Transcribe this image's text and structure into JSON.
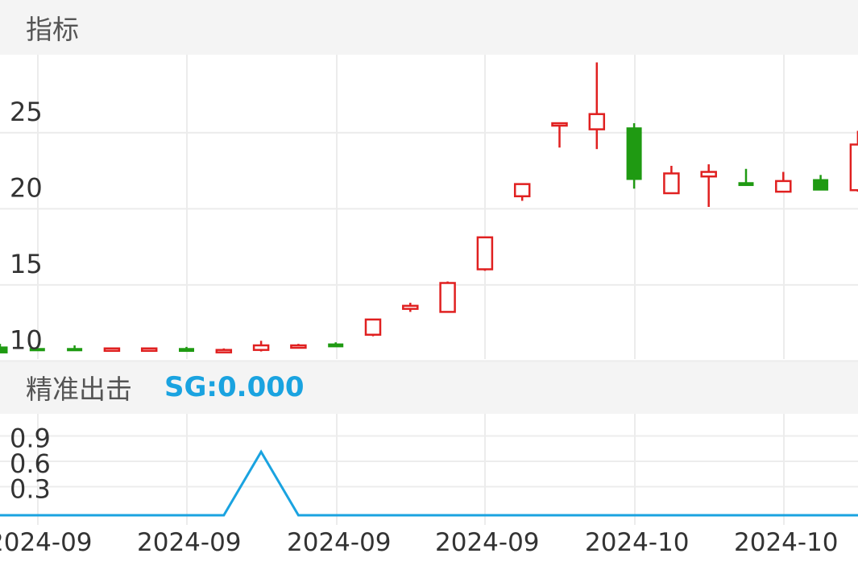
{
  "colors": {
    "up": "#e02020",
    "down": "#1f9a12",
    "signal": "#1aa3e0",
    "grid": "#ececec",
    "header_bg": "#f4f4f4"
  },
  "panels": {
    "price": {
      "title": "指标"
    },
    "signal": {
      "title": "精准出击",
      "value_label": "SG:0.000"
    }
  },
  "chart_data": [
    {
      "type": "candlestick",
      "title": "指标",
      "ylim": [
        8.8,
        28.8
      ],
      "yticks": [
        10,
        15,
        20,
        25
      ],
      "xtick_labels": [
        "2024-09",
        "2024-09",
        "2024-09",
        "2024-09",
        "2024-10",
        "2024-10"
      ],
      "candles": [
        {
          "o": 9.6,
          "h": 9.8,
          "l": 9.3,
          "c": 9.2
        },
        {
          "o": 9.5,
          "h": 9.6,
          "l": 9.4,
          "c": 9.4
        },
        {
          "o": 9.5,
          "h": 9.7,
          "l": 9.4,
          "c": 9.4
        },
        {
          "o": 9.4,
          "h": 9.5,
          "l": 9.3,
          "c": 9.5
        },
        {
          "o": 9.4,
          "h": 9.5,
          "l": 9.3,
          "c": 9.5
        },
        {
          "o": 9.5,
          "h": 9.6,
          "l": 9.3,
          "c": 9.3
        },
        {
          "o": 9.3,
          "h": 9.5,
          "l": 9.3,
          "c": 9.4
        },
        {
          "o": 9.4,
          "h": 10.0,
          "l": 9.3,
          "c": 9.7
        },
        {
          "o": 9.6,
          "h": 9.8,
          "l": 9.5,
          "c": 9.7
        },
        {
          "o": 9.8,
          "h": 9.9,
          "l": 9.6,
          "c": 9.6
        },
        {
          "o": 10.4,
          "h": 11.4,
          "l": 10.3,
          "c": 11.4
        },
        {
          "o": 12.1,
          "h": 12.5,
          "l": 11.9,
          "c": 12.3
        },
        {
          "o": 11.9,
          "h": 13.9,
          "l": 11.9,
          "c": 13.8
        },
        {
          "o": 14.7,
          "h": 16.8,
          "l": 14.6,
          "c": 16.8
        },
        {
          "o": 19.5,
          "h": 20.3,
          "l": 19.2,
          "c": 20.3
        },
        {
          "o": 24.2,
          "h": 24.2,
          "l": 22.7,
          "c": 24.3
        },
        {
          "o": 23.9,
          "h": 28.3,
          "l": 22.6,
          "c": 24.9
        },
        {
          "o": 24.0,
          "h": 24.3,
          "l": 20.0,
          "c": 20.6
        },
        {
          "o": 19.7,
          "h": 21.5,
          "l": 19.7,
          "c": 21.0
        },
        {
          "o": 20.8,
          "h": 21.6,
          "l": 18.8,
          "c": 21.1
        },
        {
          "o": 20.4,
          "h": 21.3,
          "l": 20.2,
          "c": 20.2
        },
        {
          "o": 19.8,
          "h": 21.1,
          "l": 19.8,
          "c": 20.5
        },
        {
          "o": 20.6,
          "h": 20.9,
          "l": 19.9,
          "c": 19.9
        },
        {
          "o": 19.9,
          "h": 23.8,
          "l": 19.8,
          "c": 22.9
        }
      ]
    },
    {
      "type": "line",
      "title": "精准出击",
      "series": [
        {
          "name": "SG",
          "values": [
            0,
            0,
            0,
            0,
            0,
            0,
            0,
            0.75,
            0,
            0,
            0,
            0,
            0,
            0,
            0,
            0,
            0,
            0,
            0,
            0,
            0,
            0,
            0,
            0
          ]
        }
      ],
      "ylim": [
        0,
        1.2
      ],
      "yticks": [
        0.3,
        0.6,
        0.9
      ]
    }
  ]
}
